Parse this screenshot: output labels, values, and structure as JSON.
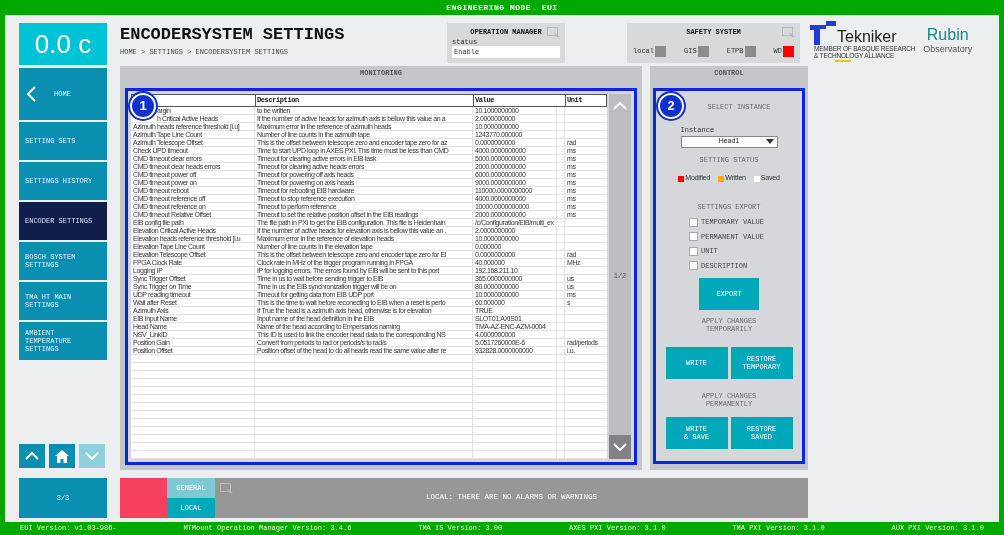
{
  "window": {
    "title": "ENGINEERING MODE. EUI"
  },
  "temperature": "0.0 c",
  "nav": [
    {
      "label": "HOME",
      "kind": "back",
      "selected": false
    },
    {
      "label": "SETTING SETS",
      "kind": "plain",
      "selected": false
    },
    {
      "label": "SETTINGS HISTORY",
      "kind": "plain",
      "selected": false
    },
    {
      "label": "ENCODER SETTINGS",
      "kind": "plain",
      "selected": true
    },
    {
      "label": "BOSCH SYSTEM SETTINGS",
      "kind": "plain",
      "selected": false
    },
    {
      "label": "TMA HT MAIN SETTINGS",
      "kind": "plain",
      "selected": false
    },
    {
      "label": "AMBIENT TEMPERATURE SETTINGS",
      "kind": "plain",
      "selected": false
    }
  ],
  "nav_arrows": [
    {
      "kind": "up",
      "disabled": false
    },
    {
      "kind": "home",
      "disabled": false
    },
    {
      "kind": "down",
      "disabled": true
    }
  ],
  "page_indicator": "3/3",
  "header": {
    "title": "ENCODERSYSTEM SETTINGS",
    "breadcrumb": "HOME > SETTINGS > ENCODERSYSTEM SETTINGS"
  },
  "operation_manager": {
    "title": "OPERATION MANAGER",
    "status_label": "status",
    "status": "Enable"
  },
  "safety_system": {
    "title": "SAFETY SYSTEM",
    "indicators": [
      {
        "label": "local",
        "color": "#8c8c8c"
      },
      {
        "label": "GIS",
        "color": "#8c8c8c"
      },
      {
        "label": "ETPB",
        "color": "#8c8c8c"
      },
      {
        "label": "WD",
        "color": "#ff0000"
      }
    ]
  },
  "logos": {
    "tekniker": "Tekniker",
    "tekniker_tagline": [
      "MEMBER OF BASQUE RESEARCH",
      "& TECHNOLOGY ALLIANCE"
    ],
    "rubin": "Rubin",
    "rubin_sub": "Observatory"
  },
  "monitoring": {
    "title": "MONITORING",
    "badge": "1",
    "page": "1/2",
    "columns": [
      "",
      "Description",
      "Value",
      "Unit"
    ],
    "rows": [
      [
        "argin",
        "to be written",
        "10.1000000000",
        ""
      ],
      [
        "h Critical Active Heads",
        "If the number of active heads for azimuth axis is bellow this value an a",
        "2.0000000000",
        ""
      ],
      [
        "Azimuth heads reference threshold [i.u]",
        "Maximum error in the reference of azimuth heads",
        "10.0000000000",
        ""
      ],
      [
        "Azimuth Tape Line Count",
        "Number of line counts in the azimuth tape",
        "1243770.000000",
        ""
      ],
      [
        "Azimuth Telescope Offset",
        "This is the offset between telescope zero and encoder tape zero for az",
        "0.0000000000",
        "rad"
      ],
      [
        "Check UPD timeout",
        "Time to start UPD loop in AXES PXI. This time must be less than CMD",
        "4000.0000000000",
        "ms"
      ],
      [
        "CMD timeout clear errors",
        "Timeout for  clearing active errors in EIB task",
        "5000.0000000000",
        "ms"
      ],
      [
        "CMD timeout clear heads errors",
        "Timeout for  clearing active heads errors",
        "2000.0000000000",
        "ms"
      ],
      [
        "CMD timeout power off",
        "Timeout for  powering off axis heads",
        "6000.0000000000",
        "ms"
      ],
      [
        "CMD timeout power on",
        "Timeout for  powering on axis heads",
        "9000.0000000000",
        "ms"
      ],
      [
        "CMD timeout reboot",
        "Timeout for rebooting EIB hardware",
        "110000.0000000000",
        "ms"
      ],
      [
        "CMD timeout reference off",
        "Timeout to stop reference execution",
        "4000.0000000000",
        "ms"
      ],
      [
        "CMD timeout reference on",
        "Timeout to perform reference",
        "10000.0000000000",
        "ms"
      ],
      [
        "CMD timeout Relative Offset",
        "Timeout to set the relative position offset in the EIB readings",
        "2000.0000000000",
        "ms"
      ],
      [
        "EIB config file path",
        "The file path in PXI to get the EIB configuration. This file is Heidenhain",
        "/c/Configuration/EIB/multi_ex",
        ""
      ],
      [
        "Elevation Critical Active Heads",
        "If the number of active heads for elevation axis is bellow this value an .",
        "2.0000000000",
        ""
      ],
      [
        "Elevation heads reference threshold [i.u",
        "Maximum error in the reference of elevation heads",
        "10.0000000000",
        ""
      ],
      [
        "Elevation Tape Line Count",
        "Number of line counts in the elevation tape",
        "0.000000",
        ""
      ],
      [
        "Elevation Telescope Offset",
        "This is the offset between telescope zero and encoder tape zero for El",
        "0.0000000000",
        "rad"
      ],
      [
        "FPGA Clock Rate",
        "Clock rate in MHz of the trigger program running in FPGA",
        "40.000000",
        "MHz"
      ],
      [
        "Logging IP",
        "IP for logging errors. The errors found by EIB will be sent to this port",
        "192.168.211.10",
        ""
      ],
      [
        "Sync Trigger Offset",
        "Time in us to wait before sending trigger to EIB",
        "365.0000000000",
        "us"
      ],
      [
        "Sync Trigger on Time",
        "Time in us the EIB synchronization trigger will be on",
        "80.0000000000",
        "us"
      ],
      [
        "UDP reading timeout",
        "Timeout for getting data from EIB UDP port",
        "10.0000000000",
        "ms"
      ],
      [
        "Wait after Reset",
        "This is the time to wait before reconecting to EIB when a reset is perfo",
        "60.000000",
        "s"
      ],
      [
        "Azimuth Axis",
        "If True the head is a azimuth axis head, otherwise is for elevation",
        "TRUE",
        ""
      ],
      [
        "EIB Input Name",
        "Input name of the head definition in the EIB",
        "SLOT01:AXIS01",
        ""
      ],
      [
        "Head Name",
        "Name of the head according to Empersarios naming",
        "TMA-AZ-ENC-AZM-0004",
        ""
      ],
      [
        "NSV_LinkID",
        "This ID is used to link the encoder head data to the corresponding NS",
        "4.0000000000",
        ""
      ],
      [
        "Position Gain",
        "Convert from periods to rad or periods/s to rad/s",
        "5.0517260000E-6",
        "rad/periods"
      ],
      [
        "Position Offset",
        "Position offset of the head to do all heads read the same value after re",
        "932828.0000000000",
        "i.u."
      ]
    ]
  },
  "control": {
    "title": "CONTROL",
    "badge": "2",
    "select_heading": "SELECT INSTANCE",
    "instance_label": "Instance",
    "instance": "Head1",
    "status_heading": "SETTING STATUS",
    "legend": [
      {
        "label": "Modified",
        "color": "#ff0000"
      },
      {
        "label": "Written",
        "color": "#ffaa00"
      },
      {
        "label": "Saved",
        "color": "#ffffff"
      }
    ],
    "export_heading": "SETTINGS EXPORT",
    "export_options": [
      {
        "label": "TEMPORARY VALUE",
        "checked": false
      },
      {
        "label": "PERMANENT VALUE",
        "checked": false
      },
      {
        "label": "UNIT",
        "checked": false
      },
      {
        "label": "DESCRIPTION",
        "checked": false
      }
    ],
    "export_button": "EXPORT",
    "temporary_heading": [
      "APPLY CHANGES",
      "TEMPORARILY"
    ],
    "temporary_buttons": [
      [
        "WRITE"
      ],
      [
        "RESTORE",
        "TEMPORARY"
      ]
    ],
    "permanent_heading": [
      "APPLY CHANGES",
      "PERMANENTLY"
    ],
    "permanent_buttons": [
      [
        "WRITE",
        "& SAVE"
      ],
      [
        "RESTORE",
        "SAVED"
      ]
    ]
  },
  "alarms": {
    "tabs": [
      {
        "label": "GENERAL",
        "selected": false
      },
      {
        "label": "LOCAL",
        "selected": true
      }
    ],
    "message": "LOCAL: THERE ARE NO ALARMS OR WARNINGS"
  },
  "status_bar": [
    "EUI Version: v1.03-986-",
    "MTMount Operation Manager Version: 3.4.6",
    "TMA IS Version: 3.00",
    "AXES PXI Version: 3.1.0",
    "TMA PXI Version: 3.1.0",
    "AUX PXI Version: 3.1.0"
  ]
}
